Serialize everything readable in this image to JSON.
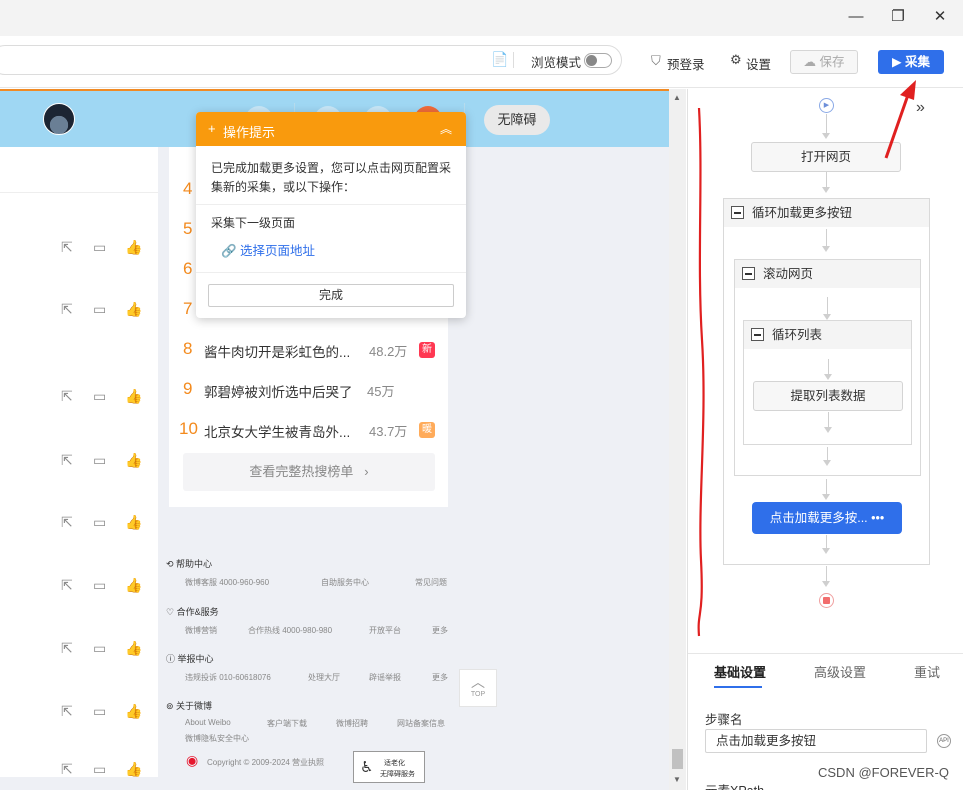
{
  "window": {
    "minimize": "—",
    "restore": "❐",
    "close": "✕"
  },
  "toolbar": {
    "browse_mode": "浏览模式",
    "pre_login": "预登录",
    "settings": "设置",
    "save": "保存",
    "collect": "▶ 采集"
  },
  "weibo": {
    "a11y_button": "无障碍",
    "hot_list": [
      {
        "rank": "4"
      },
      {
        "rank": "5"
      },
      {
        "rank": "6"
      },
      {
        "rank": "7"
      },
      {
        "rank": "8",
        "title": "酱牛肉切开是彩虹色的...",
        "count": "48.2万",
        "badge": "新"
      },
      {
        "rank": "9",
        "title": "郭碧婷被刘忻选中后哭了",
        "count": "45万"
      },
      {
        "rank": "10",
        "title": "北京女大学生被青岛外...",
        "count": "43.7万",
        "badge": "暖"
      }
    ],
    "hot_more": "查看完整热搜榜单",
    "footer": {
      "help_title": "帮助中心",
      "help_links": [
        "微博客服 4000-960-960",
        "自助服务中心",
        "常见问题"
      ],
      "coop_title": "合作&服务",
      "coop_links": [
        "微博营销",
        "合作热线 4000-980-980",
        "开放平台",
        "更多"
      ],
      "report_title": "举报中心",
      "report_links": [
        "违规投诉 010-60618076",
        "处理大厅",
        "辟谣举报",
        "更多"
      ],
      "about_title": "关于微博",
      "about_links": [
        "About Weibo",
        "客户端下载",
        "微博招聘",
        "网站备案信息"
      ],
      "privacy": "微博隐私安全中心",
      "copyright": "Copyright © 2009-2024 营业执照",
      "a11y_badge_1": "适老化",
      "a11y_badge_2": "无障碍服务",
      "top": "TOP"
    }
  },
  "tip": {
    "title": "操作提示",
    "body": "已完成加载更多设置，您可以点击网页配置采集新的采集，或以下操作：",
    "next_level": "采集下一级页面",
    "link": "选择页面地址",
    "done": "完成"
  },
  "workflow": {
    "open_page": "打开网页",
    "loop_load_more": "循环加载更多按钮",
    "scroll_page": "滚动网页",
    "loop_list": "循环列表",
    "extract_list": "提取列表数据",
    "click_load_more": "点击加载更多按...",
    "more": "•••"
  },
  "props": {
    "tabs": [
      "基础设置",
      "高级设置",
      "重试"
    ],
    "step_name_label": "步骤名",
    "step_name_value": "点击加载更多按钮",
    "api": "API",
    "element_xpath_label": "元素XPath"
  },
  "watermark": "CSDN @FOREVER-Q",
  "colors": {
    "accent": "#2f6fea",
    "tip_orange": "#f99a0d",
    "rank_orange": "#f38a1d",
    "annotation_red": "#e02020"
  }
}
